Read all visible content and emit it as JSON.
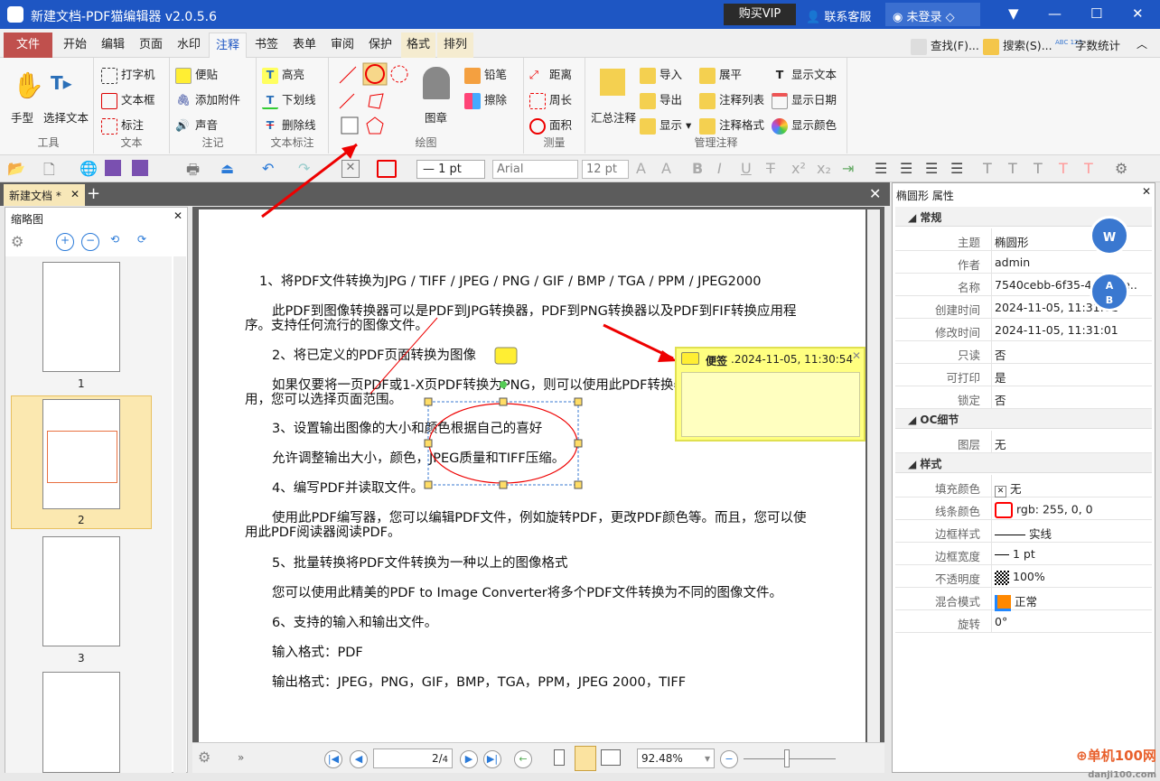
{
  "title": "新建文档-PDF猫编辑器 v2.0.5.6",
  "titlebar": {
    "buy_vip": "购买VIP",
    "support": "联系客服",
    "login": "未登录"
  },
  "menu_tabs": [
    "文件",
    "开始",
    "编辑",
    "页面",
    "水印",
    "注释",
    "书签",
    "表单",
    "审阅",
    "保护",
    "格式",
    "排列"
  ],
  "active_tab": "注释",
  "quick": {
    "find": "查找(F)...",
    "search": "搜索(S)...",
    "wordcount": "字数统计",
    "wordcount_icon_text": "ABC 123"
  },
  "ribbon": {
    "tools": {
      "label": "工具",
      "hand": "手型",
      "select_text": "选择文本"
    },
    "text": {
      "label": "文本",
      "typewriter": "打字机",
      "textbox": "文本框",
      "callout": "标注"
    },
    "notes": {
      "label": "注记",
      "sticky": "便贴",
      "attach": "添加附件",
      "sound": "声音"
    },
    "markup": {
      "label": "文本标注",
      "highlight": "高亮",
      "underline": "下划线",
      "strikeout": "删除线"
    },
    "drawing": {
      "label": "绘图",
      "stamp": "图章",
      "pencil": "铅笔",
      "eraser": "擦除"
    },
    "measure": {
      "label": "测量",
      "distance": "距离",
      "perimeter": "周长",
      "area": "面积"
    },
    "manage": {
      "label": "管理注释",
      "summary": "汇总注释",
      "import": "导入",
      "export": "导出",
      "show": "显示",
      "flatten": "展平",
      "list": "注释列表",
      "format": "注释格式",
      "show_text": "显示文本",
      "show_date": "显示日期",
      "show_color": "显示颜色"
    }
  },
  "toolbar": {
    "line_width": "1 pt",
    "font": "Arial",
    "font_size": "12 pt"
  },
  "doc_tab": "新建文档 *",
  "thumbnails": {
    "title": "缩略图",
    "pages": [
      "1",
      "2",
      "3"
    ],
    "selected": "2"
  },
  "document": {
    "lines": [
      "1、将PDF文件转换为JPG / TIFF / JPEG / PNG / GIF / BMP / TGA / PPM / JPEG2000",
      "此PDF到图像转换器可以是PDF到JPG转换器，PDF到PNG转换器以及PDF到FIF转换应用程",
      "序。支持任何流行的图像文件。",
      "2、将已定义的PDF页面转换为图像",
      "如果仅要将一页PDF或1-X页PDF转换为PNG，则可以使用此PDF转换器。 PDF页面数已启",
      "用，您可以选择页面范围。",
      "3、设置输出图像的大小和颜色根据自己的喜好",
      "允许调整输出大小，颜色，JPEG质量和TIFF压缩。",
      "4、编写PDF并读取文件。",
      "使用此PDF编写器，您可以编辑PDF文件，例如旋转PDF，更改PDF颜色等。而且，您可以使",
      "用此PDF阅读器阅读PDF。",
      "5、批量转换将PDF文件转换为一种以上的图像格式",
      "您可以使用此精美的PDF to Image Converter将多个PDF文件转换为不同的图像文件。",
      "6、支持的输入和输出文件。",
      "输入格式：PDF",
      "输出格式：JPEG，PNG，GIF，BMP，TGA，PPM，JPEG 2000，TIFF"
    ]
  },
  "sticky_note": {
    "label": "便签",
    "date": ".2024-11-05, 11:30:54"
  },
  "navigation": {
    "page_current": "2",
    "page_total": "4",
    "zoom": "92.48%"
  },
  "properties": {
    "title": "椭圆形 属性",
    "sections": {
      "general": "常规",
      "oc": "OC细节",
      "style": "样式"
    },
    "general": [
      [
        "主题",
        "椭圆形"
      ],
      [
        "作者",
        "admin"
      ],
      [
        "名称",
        "7540cebb-6f35-4c7...de.."
      ],
      [
        "创建时间",
        "2024-11-05, 11:31:01"
      ],
      [
        "修改时间",
        "2024-11-05, 11:31:01"
      ],
      [
        "只读",
        "否"
      ],
      [
        "可打印",
        "是"
      ],
      [
        "锁定",
        "否"
      ]
    ],
    "oc": [
      [
        "图层",
        "无"
      ]
    ],
    "style": [
      [
        "填充颜色",
        "无"
      ],
      [
        "线条颜色",
        "rgb: 255, 0, 0"
      ],
      [
        "边框样式",
        "实线"
      ],
      [
        "边框宽度",
        "1 pt"
      ],
      [
        "不透明度",
        "100%"
      ],
      [
        "混合模式",
        "正常"
      ],
      [
        "旋转",
        "0°"
      ]
    ]
  },
  "overlay": {
    "convert_a": "A",
    "convert_b": "B",
    "word": "W"
  },
  "watermark": {
    "site": "单机100网",
    "url": "danji100.com"
  },
  "colors": {
    "titlebar": "#1e56c3",
    "file_tab": "#c0504d",
    "annotation": "#ff0000",
    "note": "#ffff99"
  }
}
